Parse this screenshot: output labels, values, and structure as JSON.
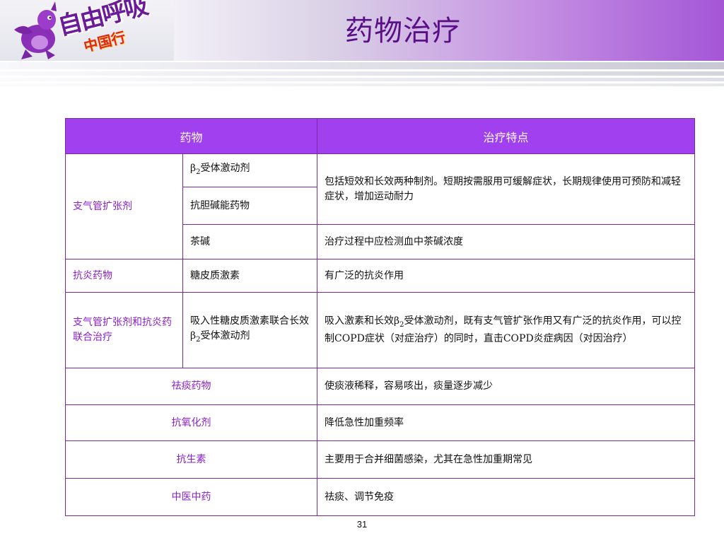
{
  "logo": {
    "line1": "自由呼吸",
    "line2": "中国行"
  },
  "title": "药物治疗",
  "table": {
    "headers": [
      "药物",
      "治疗特点"
    ],
    "rows": {
      "r1": {
        "cat": "支气管扩张剂",
        "drug": "β2受体激动剂",
        "drug_pre": "β",
        "drug_sub": "2",
        "drug_post": "受体激动剂",
        "feature": "包括短效和长效两种制剂。短期按需服用可缓解症状，长期规律使用可预防和减轻症状，增加运动耐力"
      },
      "r2": {
        "drug": "抗胆碱能药物"
      },
      "r3": {
        "drug": "茶碱",
        "feature": "治疗过程中应检测血中茶碱浓度"
      },
      "r4": {
        "cat": "抗炎药物",
        "drug": "糖皮质激素",
        "feature": "有广泛的抗炎作用"
      },
      "r5": {
        "cat": "支气管扩张剂和抗炎药联合治疗",
        "drug_pre": "吸入性糖皮质激素联合长效β",
        "drug_sub": "2",
        "drug_post": "受体激动剂",
        "feature_pre": "吸入激素和长效β",
        "feature_sub": "2",
        "feature_post": "受体激动剂，既有支气管扩张作用又有广泛的抗炎作用，可以控制COPD症状（对症治疗）的同时，直击COPD炎症病因（对因治疗）"
      },
      "r6": {
        "cat": "祛痰药物",
        "feature": "使痰液稀释，容易咳出，痰量逐步减少"
      },
      "r7": {
        "cat": "抗氧化剂",
        "feature": "降低急性加重频率"
      },
      "r8": {
        "cat": "抗生素",
        "feature": "主要用于合并细菌感染，尤其在急性加重期常见"
      },
      "r9": {
        "cat": "中医中药",
        "feature": "祛痰、调节免疫"
      }
    }
  },
  "page_number": "31",
  "colors": {
    "header_fill": "#a140ee",
    "category_text": "#8b1fc8",
    "title_text": "#5a0f86",
    "border": "#7a2a9c"
  },
  "icons": {
    "mascot": "purple-dragon-mascot-icon"
  }
}
